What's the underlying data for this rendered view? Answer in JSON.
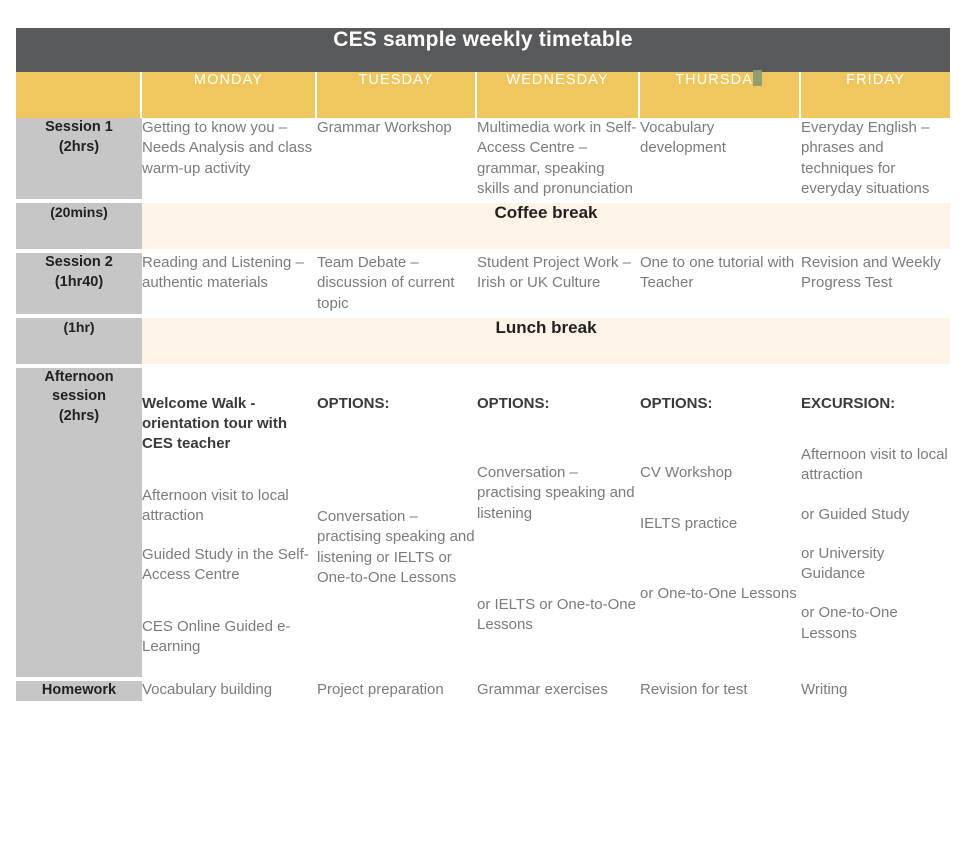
{
  "title": "CES sample weekly timetable",
  "days": [
    "MONDAY",
    "TUESDAY",
    "WEDNESDAY",
    "THURSDAY",
    "FRIDAY"
  ],
  "thursday_glitch": true,
  "colors": {
    "title_bar": "#58595B",
    "day_header": "#EFC75E",
    "row_label": "#C6C6C6",
    "break_row": "#FDF4E7",
    "body_text": "#7b7b7f",
    "heading_text": "#3a3a3c",
    "page_background": "#ffffff"
  },
  "rows": {
    "session1": {
      "label_line1": "Session 1",
      "label_line2": "(2hrs)",
      "monday": "Getting to know you – Needs Analysis and class warm-up activity",
      "tuesday": "Grammar Workshop",
      "wednesday": "Multimedia work in Self-Access Centre – grammar, speaking skills and pronunciation",
      "thursday": "Vocabulary development",
      "friday": "Everyday English – phrases and techniques for everyday situations"
    },
    "coffee_break": {
      "label": "(20mins)",
      "text": "Coffee break"
    },
    "session2": {
      "label_line1": "Session 2",
      "label_line2": "(1hr40)",
      "monday": "Reading and Listening – authentic materials",
      "tuesday": "Team Debate – discussion of current topic",
      "wednesday": "Student Project Work – Irish or UK Culture",
      "thursday": "One to one tutorial with Teacher",
      "friday": "Revision and Weekly Progress Test"
    },
    "lunch_break": {
      "label": "(1hr)",
      "text": "Lunch break"
    },
    "afternoon": {
      "label_line1": "Afternoon",
      "label_line2": "session",
      "label_line3": "(2hrs)",
      "monday": {
        "heading": "Welcome Walk - orientation tour with CES teacher",
        "item1": "Afternoon visit to local attraction",
        "item2": "Guided Study in the Self-Access Centre",
        "item3": "CES Online Guided e-Learning"
      },
      "tuesday": {
        "heading": "OPTIONS:",
        "item1": "Conversation – practising speaking and listening or IELTS or One-to-One Lessons"
      },
      "wednesday": {
        "heading": "OPTIONS:",
        "item1": "Conversation – practising speaking and listening",
        "item2": "or IELTS or One-to-One Lessons"
      },
      "thursday": {
        "heading": "OPTIONS:",
        "item1": "CV Workshop",
        "item2": "IELTS practice",
        "item3": "or One-to-One Lessons"
      },
      "friday": {
        "heading": "EXCURSION:",
        "item1": "Afternoon visit to local attraction",
        "item2": "or Guided Study",
        "item3": "or University Guidance",
        "item4": "or One-to-One Lessons"
      }
    },
    "homework": {
      "label": "Homework",
      "monday": "Vocabulary building",
      "tuesday": "Project preparation",
      "wednesday": "Grammar exercises",
      "thursday": "Revision for test",
      "friday": "Writing"
    }
  }
}
